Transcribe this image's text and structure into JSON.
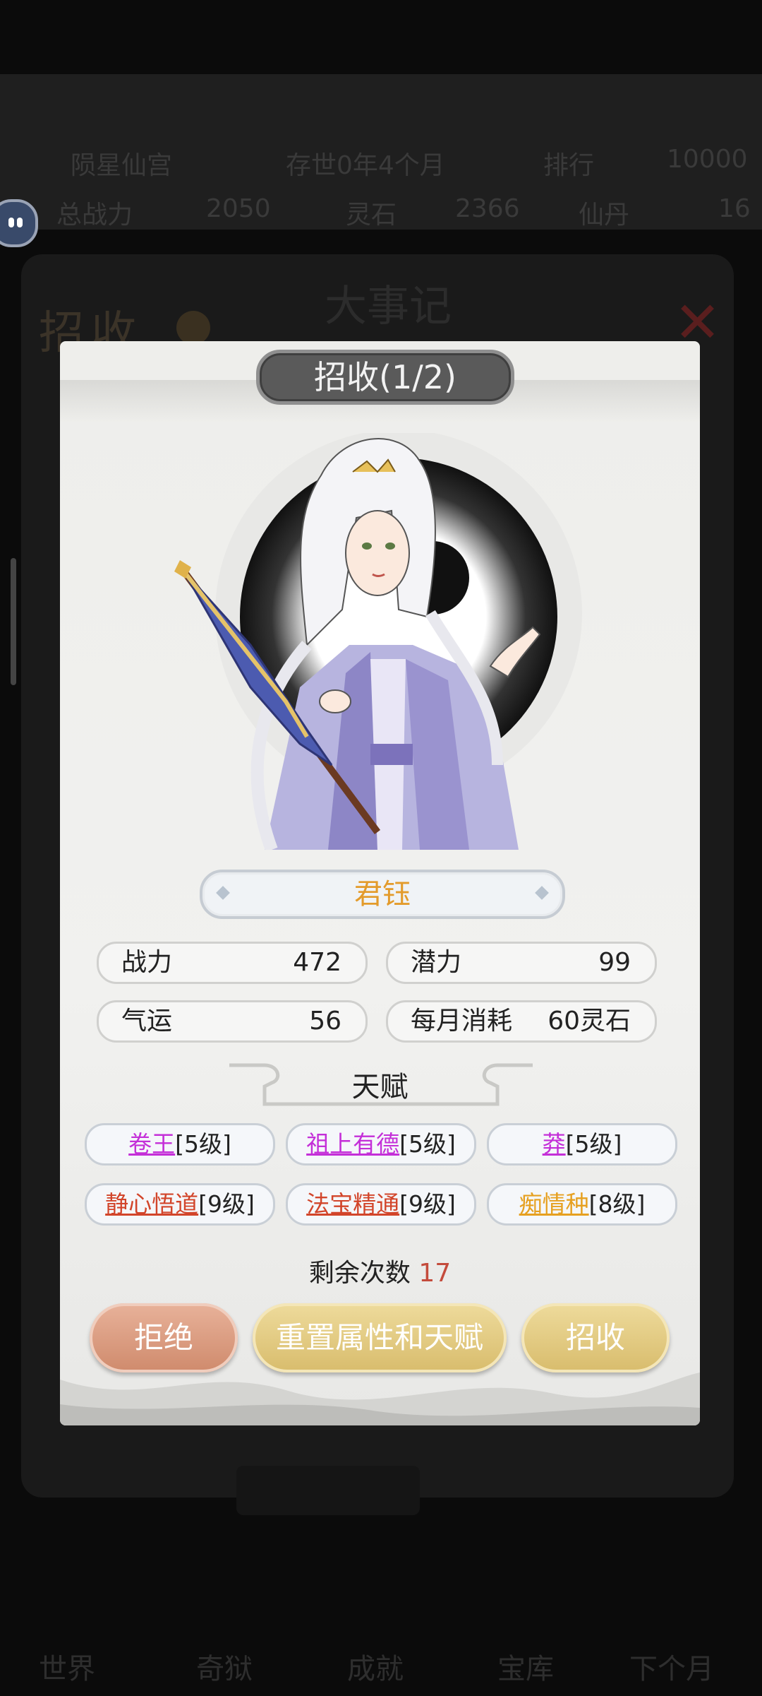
{
  "background": {
    "sect_name": "陨星仙宫",
    "exist_time": "存世0年4个月",
    "rank_label": "排行",
    "rank_value": "10000",
    "power_label": "总战力",
    "power_value": "2050",
    "stone_label": "灵石",
    "stone_value": "2366",
    "item_label": "仙丹",
    "item_value": "16",
    "panel_title": "招收",
    "mid_title": "大事记",
    "nav": [
      "世界",
      "奇狱",
      "成就",
      "宝库",
      "下个月"
    ]
  },
  "dialog": {
    "title": "招收(1/2)",
    "character_name": "君钰",
    "stats": {
      "power_label": "战力",
      "power_value": "472",
      "potential_label": "潜力",
      "potential_value": "99",
      "luck_label": "气运",
      "luck_value": "56",
      "monthly_label": "每月消耗",
      "monthly_value": "60灵石"
    },
    "talent_title": "天赋",
    "talents": [
      {
        "name": "卷王",
        "level": "[5级]",
        "color": "#c42fd8"
      },
      {
        "name": "祖上有德",
        "level": "[5级]",
        "color": "#c42fd8"
      },
      {
        "name": "莽",
        "level": "[5级]",
        "color": "#c42fd8"
      },
      {
        "name": "静心悟道",
        "level": "[9级]",
        "color": "#d2452a"
      },
      {
        "name": "法宝精通",
        "level": "[9级]",
        "color": "#d2452a"
      },
      {
        "name": "痴情种",
        "level": "[8级]",
        "color": "#e6a020"
      }
    ],
    "remaining_label": "剩余次数",
    "remaining_value": "17",
    "buttons": {
      "reject": "拒绝",
      "reset": "重置属性和天赋",
      "recruit": "招收"
    }
  }
}
